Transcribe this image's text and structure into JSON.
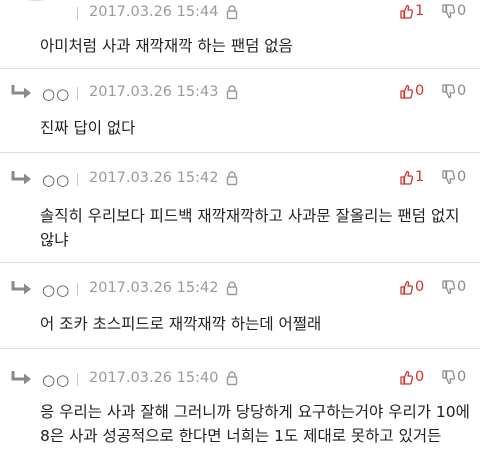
{
  "comments": [
    {
      "nick": "",
      "date": "2017.03.26 15:44",
      "up": "1",
      "down": "0",
      "text": "아미처럼 사과 재깍재깍 하는 팬덤 없음",
      "is_reply": false
    },
    {
      "nick": "○○",
      "date": "2017.03.26 15:43",
      "up": "0",
      "down": "0",
      "text": "진짜 답이 없다",
      "is_reply": true
    },
    {
      "nick": "○○",
      "date": "2017.03.26 15:42",
      "up": "1",
      "down": "0",
      "text": "솔직히 우리보다 피드백 재깍재깍하고 사과문 잘올리는 팬덤 없지않냐",
      "is_reply": true
    },
    {
      "nick": "○○",
      "date": "2017.03.26 15:42",
      "up": "0",
      "down": "0",
      "text": "어 조카 초스피드로 재깍재깍 하는데 어쩔래",
      "is_reply": true
    },
    {
      "nick": "○○",
      "date": "2017.03.26 15:40",
      "up": "0",
      "down": "0",
      "text": "응 우리는 사과 잘해 그러니까 당당하게 요구하는거야 우리가 10에 8은 사과 성공적으로 한다면 너희는 1도 제대로 못하고 있거든",
      "is_reply": true
    }
  ],
  "icons": {
    "reply": "reply-arrow-icon",
    "lock": "lock-icon",
    "up": "thumbs-up-icon",
    "down": "thumbs-down-icon"
  },
  "colors": {
    "up": "#d23232",
    "down": "#8a8a8a",
    "date": "#9a9a9a"
  }
}
